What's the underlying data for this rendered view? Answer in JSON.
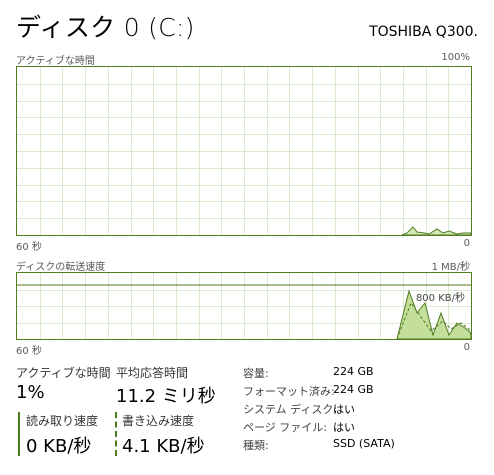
{
  "header": {
    "title": "ディスク 0 (C:)",
    "model": "TOSHIBA Q300."
  },
  "active_time_graph": {
    "label": "アクティブな時間",
    "max_label": "100%",
    "time_left_label": "60 秒",
    "time_right_label": "0",
    "colors": {
      "line": "#4f7d1f",
      "fill": "#d3e8b6",
      "grid": "#d9ead1"
    }
  },
  "transfer_graph": {
    "label": "ディスクの転送速度",
    "max_label": "1 MB/秒",
    "level_label": "800 KB/秒",
    "time_left_label": "60 秒",
    "time_right_label": "0",
    "colors": {
      "line": "#4f7d1f",
      "fill": "#c3df9b",
      "grid": "#d9ead1"
    }
  },
  "stats": {
    "active_time": {
      "label": "アクティブな時間",
      "value": "1%"
    },
    "response_time": {
      "label": "平均応答時間",
      "value": "11.2 ミリ秒"
    },
    "read_speed": {
      "label": "読み取り速度",
      "value": "0 KB/秒"
    },
    "write_speed": {
      "label": "書き込み速度",
      "value": "4.1 KB/秒"
    }
  },
  "details": [
    {
      "label": "容量:",
      "value": "224 GB"
    },
    {
      "label": "フォーマット済み:",
      "value": "224 GB"
    },
    {
      "label": "システム ディスク:",
      "value": "はい"
    },
    {
      "label": "ページ ファイル:",
      "value": "はい"
    },
    {
      "label": "種類:",
      "value": "SSD (SATA)"
    }
  ]
}
